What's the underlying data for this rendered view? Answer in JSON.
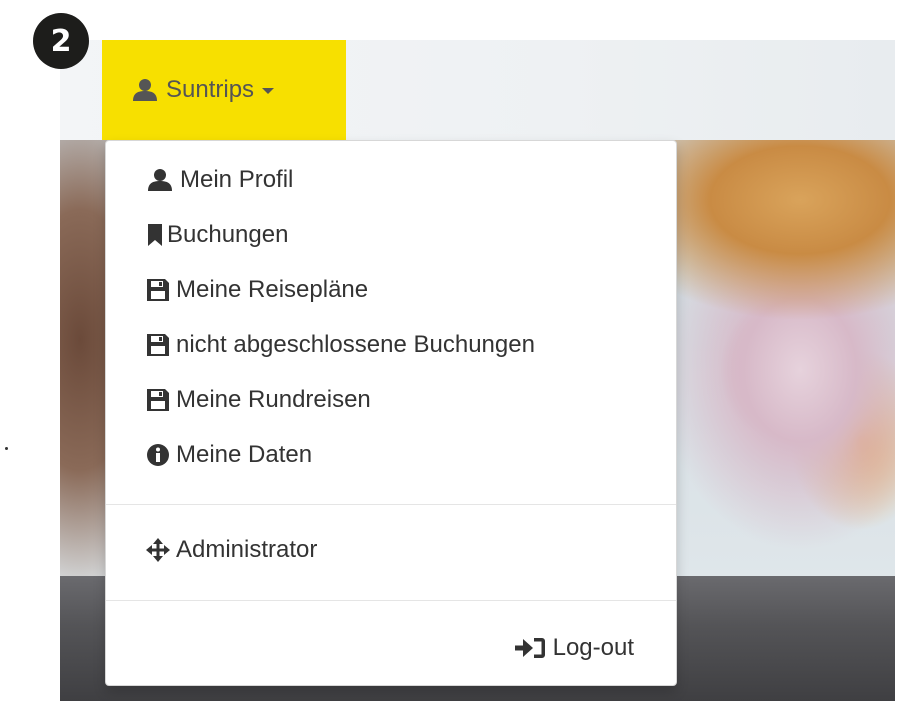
{
  "step_badge": "2",
  "user_menu": {
    "label": "Suntrips",
    "icon": "user-icon"
  },
  "menu_items": [
    {
      "label": "Mein Profil",
      "icon": "user-icon"
    },
    {
      "label": "Buchungen",
      "icon": "bookmark-icon"
    },
    {
      "label": "Meine Reisepläne",
      "icon": "floppy-disk-icon"
    },
    {
      "label": "nicht abgeschlossene Buchungen",
      "icon": "floppy-disk-icon"
    },
    {
      "label": "Meine Rundreisen",
      "icon": "floppy-disk-icon"
    },
    {
      "label": "Meine Daten",
      "icon": "info-sign-icon"
    },
    {
      "label": "Administrator",
      "icon": "move-arrows-icon"
    },
    {
      "label": "Log-out",
      "icon": "log-in-arrow-icon"
    }
  ],
  "colors": {
    "toggle_background": "#f7e000",
    "toggle_text": "#555555",
    "menu_text": "#333333",
    "badge": "#1d1d1b"
  }
}
